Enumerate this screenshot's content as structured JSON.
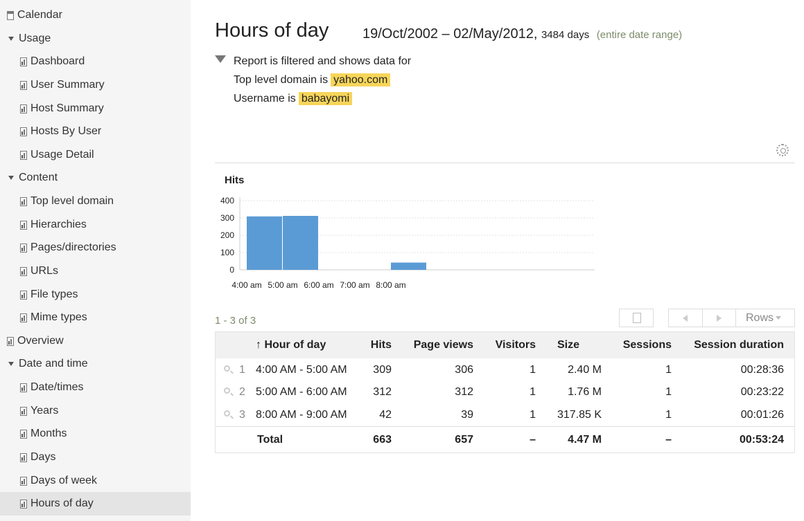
{
  "sidebar": {
    "items": [
      {
        "label": "Calendar",
        "level": 0,
        "kind": "cal"
      },
      {
        "label": "Usage",
        "level": 0,
        "kind": "group"
      },
      {
        "label": "Dashboard",
        "level": 1,
        "kind": "report"
      },
      {
        "label": "User Summary",
        "level": 1,
        "kind": "report"
      },
      {
        "label": "Host Summary",
        "level": 1,
        "kind": "report"
      },
      {
        "label": "Hosts By User",
        "level": 1,
        "kind": "report"
      },
      {
        "label": "Usage Detail",
        "level": 1,
        "kind": "report"
      },
      {
        "label": "Content",
        "level": 0,
        "kind": "group"
      },
      {
        "label": "Top level domain",
        "level": 1,
        "kind": "report"
      },
      {
        "label": "Hierarchies",
        "level": 1,
        "kind": "report"
      },
      {
        "label": "Pages/directories",
        "level": 1,
        "kind": "report"
      },
      {
        "label": "URLs",
        "level": 1,
        "kind": "report"
      },
      {
        "label": "File types",
        "level": 1,
        "kind": "report"
      },
      {
        "label": "Mime types",
        "level": 1,
        "kind": "report"
      },
      {
        "label": "Overview",
        "level": 0,
        "kind": "report"
      },
      {
        "label": "Date and time",
        "level": 0,
        "kind": "group"
      },
      {
        "label": "Date/times",
        "level": 1,
        "kind": "report"
      },
      {
        "label": "Years",
        "level": 1,
        "kind": "report"
      },
      {
        "label": "Months",
        "level": 1,
        "kind": "report"
      },
      {
        "label": "Days",
        "level": 1,
        "kind": "report"
      },
      {
        "label": "Days of week",
        "level": 1,
        "kind": "report"
      },
      {
        "label": "Hours of day",
        "level": 1,
        "kind": "report",
        "selected": true
      }
    ]
  },
  "header": {
    "title": "Hours of day",
    "date_range": "19/Oct/2002 – 02/May/2012,",
    "days": "3484 days",
    "entire_link": "(entire date range)"
  },
  "filter": {
    "intro": "Report is filtered and shows data for",
    "conditions": [
      {
        "text": "Top level domain is",
        "value": "yahoo.com"
      },
      {
        "text": "Username is",
        "value": "babayomi"
      }
    ]
  },
  "chart_data": {
    "type": "bar",
    "title": "Hits",
    "categories": [
      "4:00 am",
      "5:00 am",
      "6:00 am",
      "7:00 am",
      "8:00 am"
    ],
    "values": [
      309,
      312,
      0,
      0,
      42
    ],
    "ylim": [
      0,
      400
    ],
    "yticks": [
      0,
      100,
      200,
      300,
      400
    ],
    "grid": true,
    "bar_color": "#5b9bd5"
  },
  "table": {
    "pager": "1 - 3 of 3",
    "rows_label": "Rows",
    "sort_arrow": "↑",
    "columns": [
      "Hour of day",
      "Hits",
      "Page views",
      "Visitors",
      "Size",
      "Sessions",
      "Session duration"
    ],
    "rows": [
      {
        "num": "1",
        "hour": "4:00 AM - 5:00 AM",
        "hits": "309",
        "page_views": "306",
        "visitors": "1",
        "size": "2.40 M",
        "sessions": "1",
        "duration": "00:28:36"
      },
      {
        "num": "2",
        "hour": "5:00 AM - 6:00 AM",
        "hits": "312",
        "page_views": "312",
        "visitors": "1",
        "size": "1.76 M",
        "sessions": "1",
        "duration": "00:23:22"
      },
      {
        "num": "3",
        "hour": "8:00 AM - 9:00 AM",
        "hits": "42",
        "page_views": "39",
        "visitors": "1",
        "size": "317.85 K",
        "sessions": "1",
        "duration": "00:01:26"
      }
    ],
    "total": {
      "label": "Total",
      "hits": "663",
      "page_views": "657",
      "visitors": "–",
      "size": "4.47 M",
      "sessions": "–",
      "duration": "00:53:24"
    }
  }
}
